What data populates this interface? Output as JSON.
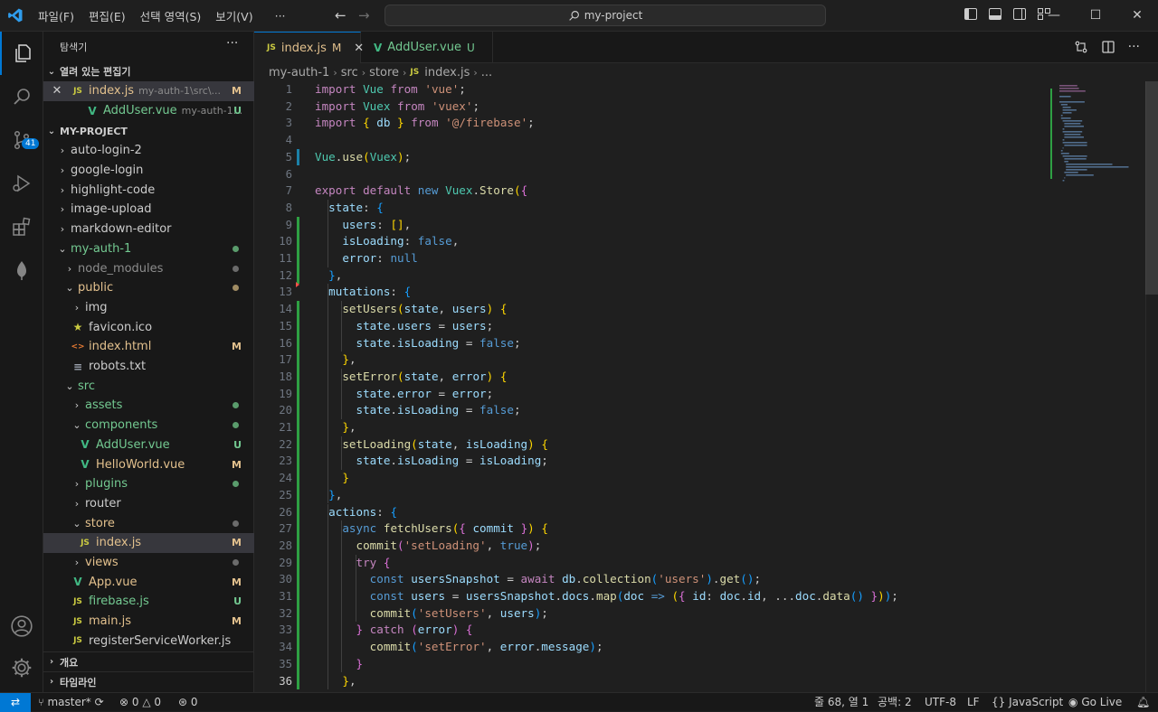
{
  "menu": [
    "파일(F)",
    "편집(E)",
    "선택 영역(S)",
    "보기(V)",
    "···"
  ],
  "command_center": "my-project",
  "window_controls": [
    "—",
    "☐",
    "✕"
  ],
  "activity_bar": {
    "items": [
      "explorer-icon",
      "search-icon",
      "source-control-icon",
      "run-debug-icon",
      "extensions-icon",
      "mongodb-icon"
    ],
    "bottom": [
      "account-icon",
      "manage-gear-icon"
    ],
    "scm_badge": "41"
  },
  "explorer": {
    "title": "탐색기",
    "more": "···",
    "open_editors_label": "열려 있는 편집기",
    "open_editors": [
      {
        "icon": "JS",
        "name": "index.js",
        "desc": "my-auth-1\\src\\...",
        "status": "M"
      },
      {
        "icon": "V",
        "name": "AddUser.vue",
        "desc": "my-auth-1...",
        "status": "U"
      }
    ],
    "project_label": "MY-PROJECT",
    "tree": [
      {
        "name": "auto-login-2",
        "chev": "›"
      },
      {
        "name": "google-login",
        "chev": "›"
      },
      {
        "name": "highlight-code",
        "chev": "›"
      },
      {
        "name": "image-upload",
        "chev": "›"
      },
      {
        "name": "markdown-editor",
        "chev": "›"
      },
      {
        "name": "my-auth-1",
        "chev": "⌄"
      },
      {
        "name": "node_modules",
        "chev": "›"
      },
      {
        "name": "public",
        "chev": "⌄"
      },
      {
        "name": "img",
        "chev": "›"
      },
      {
        "name": "favicon.ico",
        "icon": "★"
      },
      {
        "name": "index.html",
        "icon": "<>",
        "status": "M"
      },
      {
        "name": "robots.txt",
        "icon": "≡"
      },
      {
        "name": "src",
        "chev": "⌄"
      },
      {
        "name": "assets",
        "chev": "›"
      },
      {
        "name": "components",
        "chev": "⌄"
      },
      {
        "name": "AddUser.vue",
        "icon": "V",
        "status": "U"
      },
      {
        "name": "HelloWorld.vue",
        "icon": "V",
        "status": "M"
      },
      {
        "name": "plugins",
        "chev": "›"
      },
      {
        "name": "router",
        "chev": "›"
      },
      {
        "name": "store",
        "chev": "⌄"
      },
      {
        "name": "index.js",
        "icon": "JS",
        "status": "M"
      },
      {
        "name": "views",
        "chev": "›"
      },
      {
        "name": "App.vue",
        "icon": "V",
        "status": "M"
      },
      {
        "name": "firebase.js",
        "icon": "JS",
        "status": "U"
      },
      {
        "name": "main.js",
        "icon": "JS",
        "status": "M"
      },
      {
        "name": "registerServiceWorker.js",
        "icon": "JS"
      }
    ],
    "outline_label": "개요",
    "timeline_label": "타임라인"
  },
  "tabs": [
    {
      "icon": "JS",
      "label": "index.js",
      "status": "M",
      "close": "✕"
    },
    {
      "icon": "V",
      "label": "AddUser.vue",
      "status": "U"
    }
  ],
  "breadcrumb": [
    "my-auth-1",
    "src",
    "store",
    "index.js",
    "..."
  ],
  "breadcrumb_icon": "JS",
  "code_lines": [
    "import Vue from 'vue';",
    "import Vuex from 'vuex';",
    "import { db } from '@/firebase';",
    "",
    "Vue.use(Vuex);",
    "",
    "export default new Vuex.Store({",
    "  state: {",
    "    users: [],",
    "    isLoading: false,",
    "    error: null",
    "  },",
    "  mutations: {",
    "    setUsers(state, users) {",
    "      state.users = users;",
    "      state.isLoading = false;",
    "    },",
    "    setError(state, error) {",
    "      state.error = error;",
    "      state.isLoading = false;",
    "    },",
    "    setLoading(state, isLoading) {",
    "      state.isLoading = isLoading;",
    "    }",
    "  },",
    "  actions: {",
    "    async fetchUsers({ commit }) {",
    "      commit('setLoading', true);",
    "      try {",
    "        const usersSnapshot = await db.collection('users').get();",
    "        const users = usersSnapshot.docs.map(doc => ({ id: doc.id, ...doc.data() }));",
    "        commit('setUsers', users);",
    "      } catch (error) {",
    "        commit('setError', error.message);",
    "      }",
    "    },"
  ],
  "status": {
    "branch": "master*",
    "problems": "0",
    "warnings": "0",
    "ports": "0",
    "position": "줄 68, 열 1",
    "indent": "공백: 2",
    "encoding": "UTF-8",
    "eol": "LF",
    "language": "JavaScript",
    "golive": "Go Live"
  },
  "colors": {
    "accent": "#0078d4",
    "modified": "#e2c08d",
    "untracked": "#73c991",
    "js_icon": "#cbcb41",
    "vue_icon": "#41b883"
  }
}
